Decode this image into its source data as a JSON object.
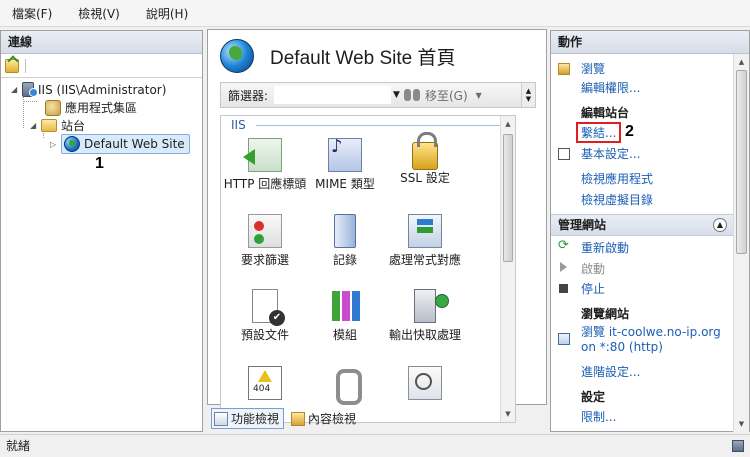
{
  "menu": [
    "檔案(F)",
    "檢視(V)",
    "說明(H)"
  ],
  "connections": {
    "header": "連線",
    "tree": {
      "server": "IIS (IIS\\Administrator)",
      "app_pools": "應用程式集區",
      "sites": "站台",
      "selected_site": "Default Web Site"
    },
    "callout_number": "1"
  },
  "center": {
    "title": "Default Web Site 首頁",
    "filter_label": "篩選器:",
    "filter_value": "",
    "goto_label": "移至(G)",
    "group_label": "IIS",
    "features": [
      {
        "icon": "http-response-headers-icon",
        "label": "HTTP 回應標頭"
      },
      {
        "icon": "mime-types-icon",
        "label": "MIME 類型"
      },
      {
        "icon": "ssl-lock-icon",
        "label": "SSL 設定"
      },
      {
        "icon": "request-filtering-icon",
        "label": "要求篩選"
      },
      {
        "icon": "logging-icon",
        "label": "記錄"
      },
      {
        "icon": "handler-mappings-icon",
        "label": "處理常式對應"
      },
      {
        "icon": "default-document-icon",
        "label": "預設文件"
      },
      {
        "icon": "modules-icon",
        "label": "模組"
      },
      {
        "icon": "output-caching-icon",
        "label": "輸出快取處理"
      },
      {
        "icon": "error-pages-icon",
        "label": ""
      },
      {
        "icon": "compression-icon",
        "label": ""
      },
      {
        "icon": "directory-browsing-icon",
        "label": ""
      }
    ],
    "view_tabs": {
      "features_view": "功能檢視",
      "content_view": "內容檢視"
    }
  },
  "actions": {
    "header": "動作",
    "browse": "瀏覽",
    "edit_permissions": "編輯權限...",
    "edit_site_heading": "編輯站台",
    "bindings": "繫結...",
    "basic_settings": "基本設定...",
    "view_applications": "檢視應用程式",
    "view_virtual_dirs": "檢視虛擬目錄",
    "manage_site_heading": "管理網站",
    "restart": "重新啟動",
    "start": "啟動",
    "stop": "停止",
    "browse_site_heading": "瀏覽網站",
    "browse_url_line1": "瀏覽 it-coolwe.no-ip.org",
    "browse_url_line2": "on *:80 (http)",
    "advanced_settings": "進階設定...",
    "settings_heading": "設定",
    "limits": "限制...",
    "callout_number": "2",
    "highlight_color": "#e01f1f"
  },
  "status": {
    "text": "就緒"
  }
}
